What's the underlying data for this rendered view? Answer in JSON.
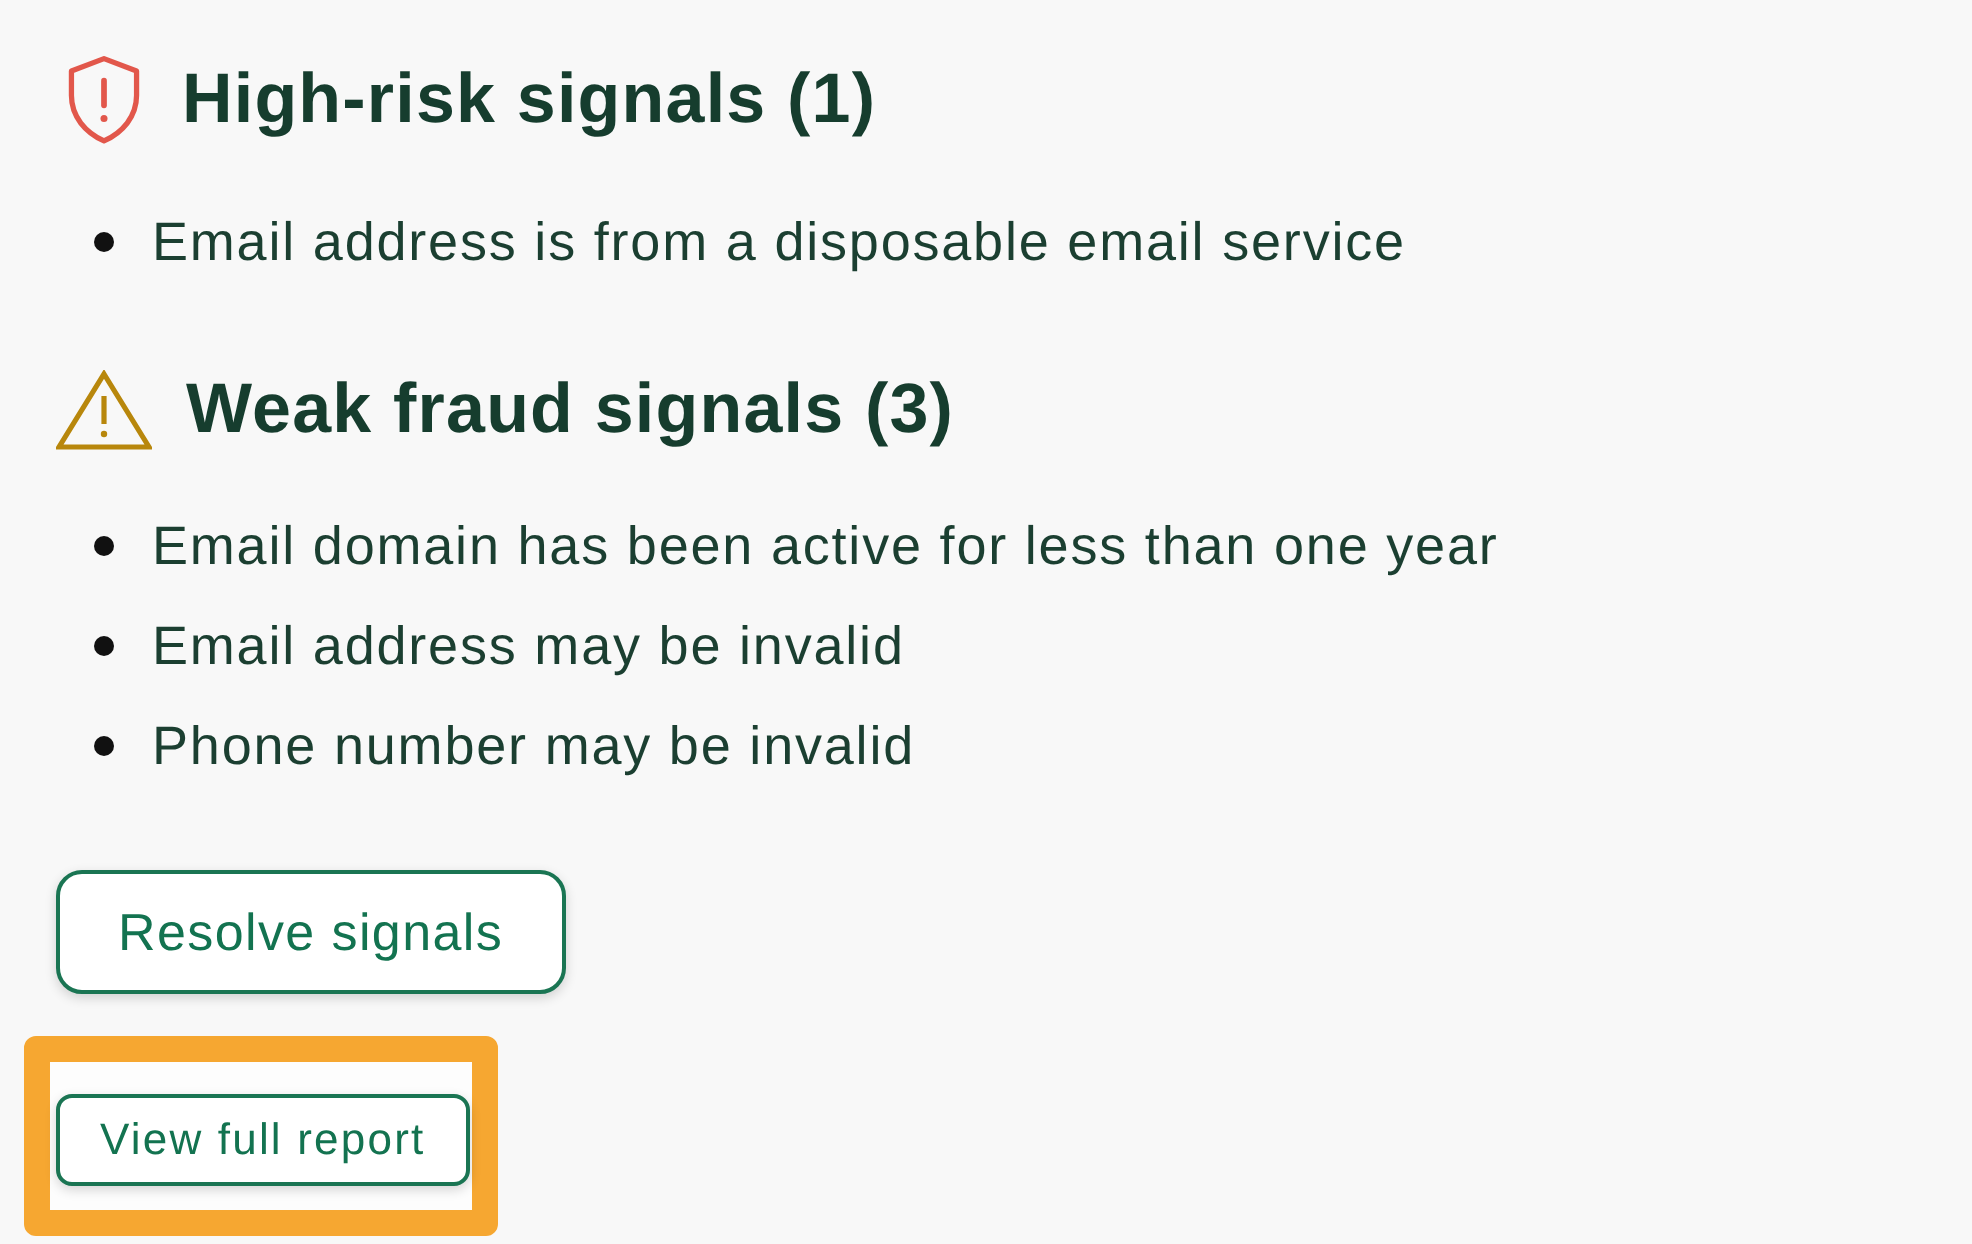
{
  "sections": [
    {
      "kind": "high-risk",
      "title": "High-risk signals (1)",
      "items": [
        "Email address is from a disposable email service"
      ]
    },
    {
      "kind": "weak",
      "title": "Weak fraud signals (3)",
      "items": [
        "Email domain has been active for less than one year",
        "Email address may be invalid",
        "Phone number may be invalid"
      ]
    }
  ],
  "actions": [
    {
      "kind": "standard",
      "label": "Resolve signals",
      "highlighted": false
    },
    {
      "kind": "compact",
      "label": "View full report",
      "highlighted": true
    }
  ]
}
